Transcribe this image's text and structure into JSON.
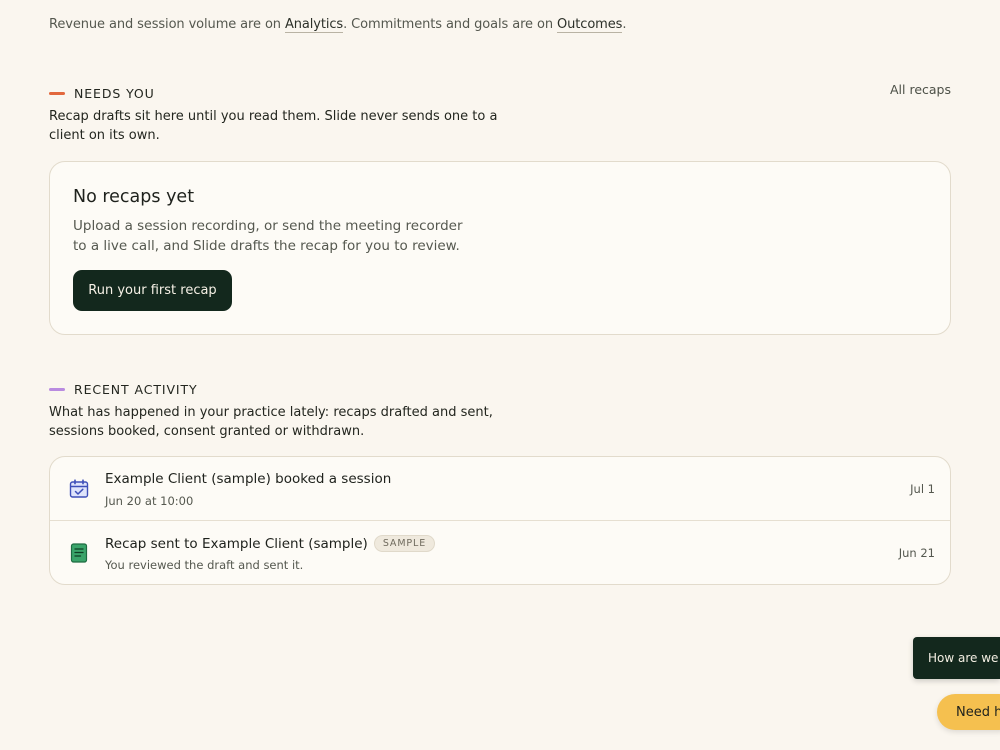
{
  "crosslinks": {
    "prefix": "Revenue and session volume are on ",
    "analytics": "Analytics",
    "middle": ". Commitments and goals are on ",
    "outcomes": "Outcomes",
    "suffix": "."
  },
  "needs_you": {
    "title": "NEEDS YOU",
    "description": "Recap drafts sit here until you read them. Slide never sends one to a client on its own.",
    "link": "All recaps",
    "empty": {
      "title": "No recaps yet",
      "description": "Upload a session recording, or send the meeting recorder to a live call, and Slide drafts the recap for you to review.",
      "button": "Run your first recap"
    }
  },
  "recent_activity": {
    "title": "RECENT ACTIVITY",
    "description": "What has happened in your practice lately: recaps drafted and sent, sessions booked, consent granted or withdrawn.",
    "items": [
      {
        "icon": "calendar-check-icon",
        "title": "Example Client (sample) booked a session",
        "subtitle": "Jun 20 at 10:00",
        "badge": "",
        "date": "Jul 1"
      },
      {
        "icon": "document-icon",
        "title": "Recap sent to Example Client (sample)",
        "subtitle": "You reviewed the draft and sent it.",
        "badge": "SAMPLE",
        "date": "Jun 21"
      }
    ]
  },
  "feedback": {
    "label": "How are we doing?"
  },
  "help": {
    "label": "Need help?"
  },
  "colors": {
    "accent_dark": "#13281d",
    "needs_you_dash": "#e2683d",
    "activity_dash": "#b98be0",
    "help_yellow": "#f5c04f",
    "calendar_blue": "#5b6fe0",
    "doc_green": "#2f9a5f"
  }
}
